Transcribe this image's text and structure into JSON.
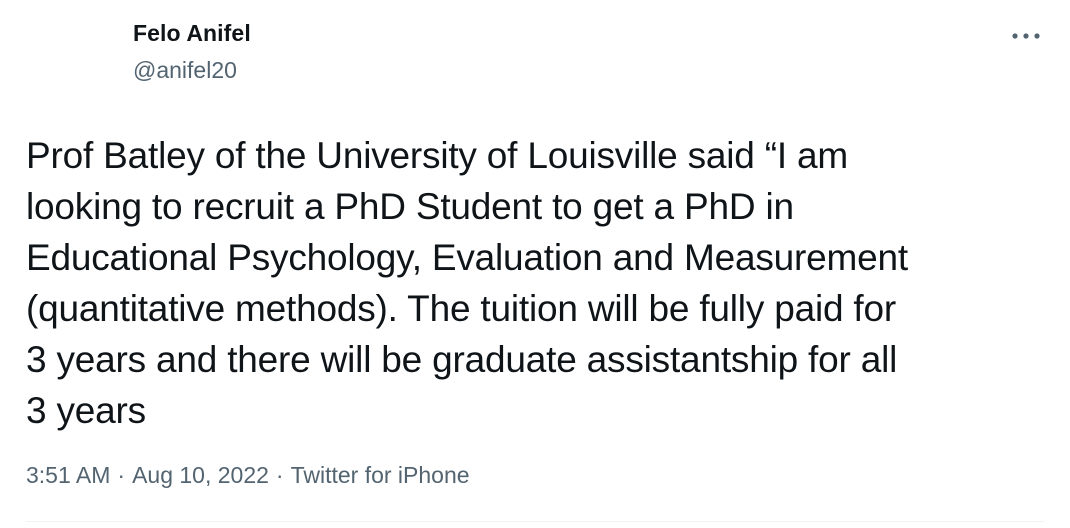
{
  "author": {
    "display_name": "Felo Anifel",
    "handle": "@anifel20"
  },
  "more_icon": "more-horizontal-icon",
  "tweet": {
    "text": "Prof Batley of the University of Louisville said “I am\nlooking to recruit a PhD Student to get a PhD in\nEducational Psychology, Evaluation and Measurement\n(quantitative methods). The tuition will be fully paid for\n3 years and there will be graduate assistantship for all\n3 years"
  },
  "meta": {
    "time": "3:51 AM",
    "separator": "·",
    "date": "Aug 10, 2022",
    "source": "Twitter for iPhone"
  },
  "colors": {
    "text_primary": "#0f1419",
    "text_secondary": "#536471",
    "divider": "#eff3f4"
  }
}
